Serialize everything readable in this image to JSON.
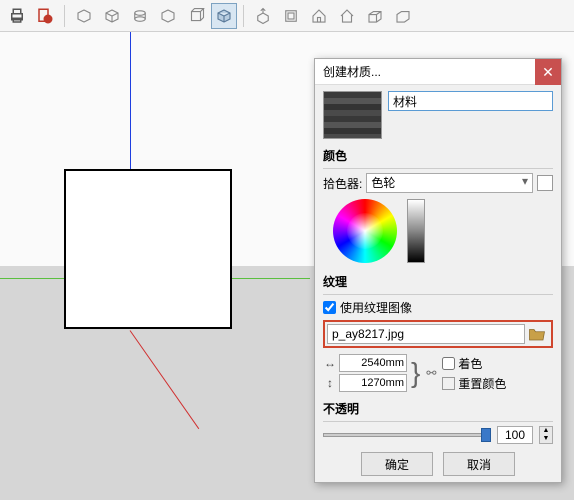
{
  "dialog": {
    "title": "创建材质...",
    "name_value": "材料",
    "color_section": "颜色",
    "picker_label": "拾色器:",
    "picker_value": "色轮",
    "texture_section": "纹理",
    "use_texture_label": "使用纹理图像",
    "file_value": "p_ay8217.jpg",
    "width_value": "2540mm",
    "height_value": "1270mm",
    "colorize_label": "着色",
    "reset_color_label": "重置颜色",
    "opacity_section": "不透明",
    "opacity_value": "100",
    "ok_label": "确定",
    "cancel_label": "取消"
  }
}
